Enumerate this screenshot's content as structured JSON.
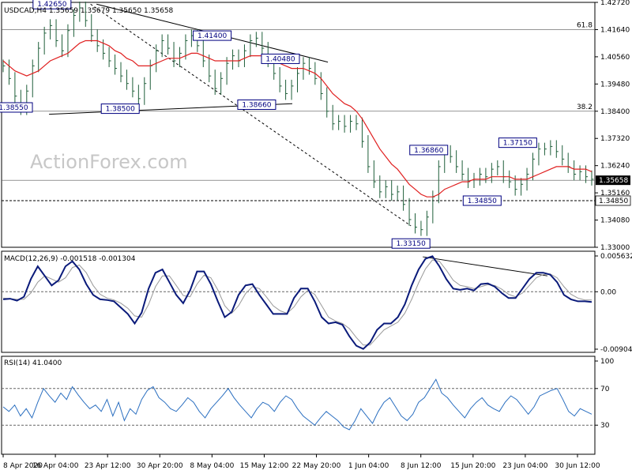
{
  "chart_data": {
    "type": "line",
    "header": {
      "symbol_text": "USDCAD,H4  1.35659 1.35679 1.35650 1.35658",
      "macd_text": "MACD(12,26,9) -0.001518 -0.001304",
      "rsi_text": "RSI(14) 41.0400"
    },
    "watermark": "ActionForex.com",
    "x_labels": [
      "8 Apr 2020",
      "16 Apr 04:00",
      "23 Apr 12:00",
      "30 Apr 20:00",
      "8 May 04:00",
      "15 May 12:00",
      "22 May 20:00",
      "1 Jun 04:00",
      "8 Jun 12:00",
      "15 Jun 20:00",
      "23 Jun 04:00",
      "30 Jun 12:00"
    ],
    "price_panel": {
      "y_ticks": [
        "1.42720",
        "1.41640",
        "1.40560",
        "1.39480",
        "1.38400",
        "1.37320",
        "1.36240",
        "1.35160",
        "1.34080",
        "1.33000"
      ],
      "ylim": [
        1.33,
        1.4272
      ],
      "current_price": "1.35658",
      "support_tag": "1.34850",
      "fib_labels": [
        {
          "text": "61.8",
          "value": 1.4164
        },
        {
          "text": "38.2",
          "value": 1.384
        }
      ],
      "horizontal_levels": [
        1.4164,
        1.384,
        1.3566,
        1.3485
      ],
      "annotations": [
        {
          "text": "1.42650",
          "value": 1.4265
        },
        {
          "text": "1.41400",
          "value": 1.414
        },
        {
          "text": "1.40480",
          "value": 1.4048
        },
        {
          "text": "1.38550",
          "value": 1.3855
        },
        {
          "text": "1.38500",
          "value": 1.385
        },
        {
          "text": "1.38660",
          "value": 1.3866
        },
        {
          "text": "1.36860",
          "value": 1.3686
        },
        {
          "text": "1.37150",
          "value": 1.3715
        },
        {
          "text": "1.34850",
          "value": 1.3485
        },
        {
          "text": "1.33150",
          "value": 1.3315
        }
      ],
      "price_series": [
        1.402,
        1.397,
        1.39,
        1.385,
        1.392,
        1.402,
        1.409,
        1.415,
        1.418,
        1.412,
        1.408,
        1.416,
        1.422,
        1.425,
        1.42,
        1.414,
        1.41,
        1.407,
        1.404,
        1.401,
        1.398,
        1.395,
        1.392,
        1.389,
        1.395,
        1.402,
        1.408,
        1.412,
        1.409,
        1.404,
        1.407,
        1.412,
        1.414,
        1.41,
        1.404,
        1.398,
        1.393,
        1.397,
        1.403,
        1.406,
        1.404,
        1.408,
        1.412,
        1.413,
        1.409,
        1.404,
        1.399,
        1.394,
        1.391,
        1.394,
        1.399,
        1.403,
        1.401,
        1.397,
        1.391,
        1.384,
        1.379,
        1.38,
        1.378,
        1.38,
        1.379,
        1.372,
        1.362,
        1.356,
        1.352,
        1.354,
        1.351,
        1.352,
        1.347,
        1.341,
        1.338,
        1.337,
        1.342,
        1.35,
        1.362,
        1.368,
        1.366,
        1.362,
        1.359,
        1.356,
        1.357,
        1.359,
        1.358,
        1.361,
        1.362,
        1.358,
        1.356,
        1.353,
        1.355,
        1.359,
        1.365,
        1.369,
        1.369,
        1.37,
        1.368,
        1.365,
        1.362,
        1.359,
        1.36,
        1.358,
        1.357
      ],
      "ma_series": [
        1.404,
        1.402,
        1.4,
        1.399,
        1.398,
        1.399,
        1.4,
        1.402,
        1.404,
        1.405,
        1.406,
        1.407,
        1.409,
        1.411,
        1.412,
        1.412,
        1.412,
        1.411,
        1.41,
        1.408,
        1.407,
        1.405,
        1.404,
        1.402,
        1.402,
        1.402,
        1.403,
        1.404,
        1.405,
        1.405,
        1.405,
        1.406,
        1.407,
        1.407,
        1.406,
        1.405,
        1.404,
        1.404,
        1.404,
        1.404,
        1.404,
        1.405,
        1.406,
        1.406,
        1.406,
        1.405,
        1.404,
        1.403,
        1.402,
        1.401,
        1.401,
        1.401,
        1.4,
        1.399,
        1.397,
        1.394,
        1.391,
        1.389,
        1.387,
        1.386,
        1.384,
        1.381,
        1.377,
        1.373,
        1.369,
        1.366,
        1.363,
        1.361,
        1.358,
        1.355,
        1.353,
        1.351,
        1.35,
        1.35,
        1.351,
        1.353,
        1.354,
        1.355,
        1.356,
        1.356,
        1.357,
        1.357,
        1.357,
        1.358,
        1.358,
        1.358,
        1.358,
        1.357,
        1.357,
        1.357,
        1.358,
        1.359,
        1.36,
        1.361,
        1.362,
        1.362,
        1.362,
        1.361,
        1.361,
        1.361,
        1.36
      ],
      "trendlines": [
        {
          "style": "solid",
          "x": [
            0.16,
            0.55
          ],
          "values": [
            1.4265,
            1.4035
          ]
        },
        {
          "style": "solid",
          "x": [
            0.08,
            0.49
          ],
          "values": [
            1.3828,
            1.387
          ]
        },
        {
          "style": "dashed",
          "x": [
            0.15,
            0.69
          ],
          "values": [
            1.4265,
            1.3385
          ]
        }
      ]
    },
    "macd_panel": {
      "y_ticks": [
        "0.005632",
        "0.00",
        "-0.009041"
      ],
      "ylim": [
        -0.009041,
        0.005632
      ],
      "macd_series": [
        -0.0012,
        -0.0011,
        -0.0014,
        -0.0008,
        0.002,
        0.004,
        0.0025,
        0.001,
        0.0018,
        0.004,
        0.0048,
        0.0035,
        0.0012,
        -0.0005,
        -0.0012,
        -0.0013,
        -0.0015,
        -0.0025,
        -0.0035,
        -0.005,
        -0.0033,
        0.0005,
        0.003,
        0.0035,
        0.0015,
        -0.0005,
        -0.0018,
        0.0002,
        0.0032,
        0.0032,
        0.0012,
        -0.0015,
        -0.004,
        -0.0032,
        -0.0005,
        0.001,
        0.0012,
        -0.0005,
        -0.002,
        -0.0035,
        -0.0035,
        -0.0035,
        -0.001,
        0.0005,
        0.0005,
        -0.0015,
        -0.004,
        -0.005,
        -0.0048,
        -0.0052,
        -0.007,
        -0.0085,
        -0.009,
        -0.008,
        -0.006,
        -0.005,
        -0.005,
        -0.004,
        -0.002,
        0.001,
        0.0035,
        0.0052,
        0.0056,
        0.004,
        0.002,
        0.0005,
        0.0003,
        0.0005,
        0.0002,
        0.0012,
        0.0013,
        0.0008,
        -0.0002,
        -0.001,
        -0.001,
        0.0005,
        0.002,
        0.003,
        0.003,
        0.0027,
        0.0015,
        -0.0005,
        -0.0012,
        -0.0015,
        -0.0015,
        -0.0016
      ],
      "signal_series": [
        -0.001,
        -0.0011,
        -0.0012,
        -0.0012,
        -0.0002,
        0.0015,
        0.0025,
        0.002,
        0.0015,
        0.0022,
        0.0038,
        0.0042,
        0.003,
        0.001,
        -0.0004,
        -0.001,
        -0.0013,
        -0.0018,
        -0.0026,
        -0.0038,
        -0.004,
        -0.002,
        0.0008,
        0.0025,
        0.0025,
        0.001,
        -0.0006,
        -0.0008,
        0.0012,
        0.0026,
        0.0022,
        0.0003,
        -0.0022,
        -0.0034,
        -0.0022,
        -0.0003,
        0.0008,
        0.0005,
        -0.0008,
        -0.0022,
        -0.003,
        -0.0034,
        -0.0024,
        -0.0008,
        0.0002,
        -0.0004,
        -0.0022,
        -0.004,
        -0.0046,
        -0.005,
        -0.0058,
        -0.0072,
        -0.0084,
        -0.0084,
        -0.0072,
        -0.006,
        -0.0054,
        -0.0048,
        -0.0034,
        -0.0012,
        0.0014,
        0.0036,
        0.005,
        0.0048,
        0.0034,
        0.0018,
        0.001,
        0.0008,
        0.0005,
        0.0008,
        0.0011,
        0.001,
        0.0004,
        -0.0004,
        -0.0008,
        -0.0002,
        0.001,
        0.0022,
        0.0027,
        0.0028,
        0.0022,
        0.0008,
        -0.0004,
        -0.001,
        -0.0013,
        -0.0013
      ],
      "trendline": {
        "x": [
          0.71,
          0.92
        ],
        "values": [
          0.0055,
          0.0025
        ]
      }
    },
    "rsi_panel": {
      "y_ticks": [
        "100",
        "70",
        "30",
        "0"
      ],
      "ylim": [
        0,
        100
      ],
      "levels": [
        70,
        30
      ],
      "rsi_series": [
        50,
        45,
        52,
        40,
        48,
        38,
        55,
        70,
        62,
        55,
        65,
        58,
        72,
        63,
        55,
        48,
        52,
        45,
        58,
        40,
        55,
        35,
        48,
        42,
        58,
        68,
        72,
        60,
        55,
        48,
        45,
        52,
        60,
        55,
        45,
        38,
        48,
        55,
        62,
        70,
        60,
        52,
        45,
        38,
        48,
        55,
        52,
        45,
        55,
        62,
        58,
        48,
        40,
        35,
        30,
        38,
        45,
        40,
        35,
        28,
        25,
        35,
        48,
        40,
        32,
        45,
        55,
        60,
        50,
        40,
        35,
        42,
        55,
        60,
        70,
        80,
        65,
        60,
        52,
        45,
        38,
        48,
        55,
        60,
        52,
        48,
        45,
        55,
        62,
        58,
        50,
        42,
        50,
        62,
        65,
        68,
        70,
        58,
        45,
        40,
        48,
        45,
        42
      ]
    }
  }
}
